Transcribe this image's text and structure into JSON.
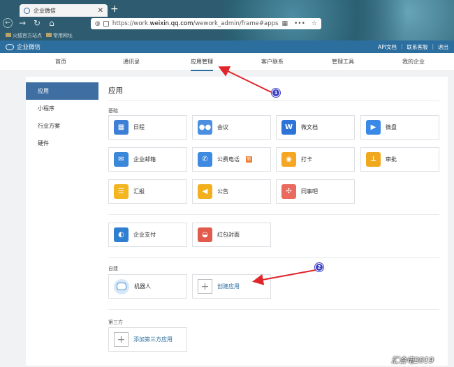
{
  "browser": {
    "tab_title": "企业微信",
    "url_prefix": "https://work.",
    "url_domain": "weixin.qq.com",
    "url_path": "/wework_admin/frame#apps",
    "bookmarks": [
      "火狐官方站点",
      "常用网址"
    ]
  },
  "header": {
    "logo": "企业微信",
    "links": [
      "API文档",
      "联系客服",
      "退出"
    ]
  },
  "topnav": {
    "items": [
      "首页",
      "通讯录",
      "应用管理",
      "客户联系",
      "管理工具",
      "我的企业"
    ],
    "active": "应用管理"
  },
  "sidebar": {
    "items": [
      "应用",
      "小程序",
      "行业方案",
      "硬件"
    ]
  },
  "main": {
    "title": "应用",
    "section_basic": "基础",
    "section_custom": "自建",
    "section_third": "第三方",
    "apps_basic": [
      {
        "label": "日程",
        "icon": "calendar-icon",
        "color": "#3d7fd6"
      },
      {
        "label": "会议",
        "icon": "meeting-icon",
        "color": "#4c8fe0"
      },
      {
        "label": "微文档",
        "icon": "doc-icon",
        "color": "#2e74d8"
      },
      {
        "label": "微盘",
        "icon": "drive-icon",
        "color": "#3a89e6"
      },
      {
        "label": "企业邮箱",
        "icon": "mail-icon",
        "color": "#3b87d9"
      },
      {
        "label": "公费电话",
        "icon": "phone-icon",
        "color": "#3d8ae0",
        "badge": "新"
      },
      {
        "label": "打卡",
        "icon": "location-icon",
        "color": "#f5a623"
      },
      {
        "label": "审批",
        "icon": "stamp-icon",
        "color": "#f0a81e"
      },
      {
        "label": "汇报",
        "icon": "report-icon",
        "color": "#f3b520"
      },
      {
        "label": "公告",
        "icon": "megaphone-icon",
        "color": "#f2b01f"
      },
      {
        "label": "同事吧",
        "icon": "community-icon",
        "color": "#ea6a5e"
      }
    ],
    "apps_extra": [
      {
        "label": "企业支付",
        "icon": "pay-icon",
        "color": "#2f7fd1"
      },
      {
        "label": "红包封面",
        "icon": "redpacket-icon",
        "color": "#e15a4b"
      }
    ],
    "custom": [
      {
        "label": "机器人",
        "icon": "robot-icon"
      },
      {
        "label": "创建应用",
        "icon": "plus-icon"
      }
    ],
    "third_party_button": "添加第三方应用"
  },
  "annotations": {
    "callout1": "1",
    "callout2": "2",
    "arrow_color": "#e0262b"
  },
  "watermark": "汇合电2019"
}
